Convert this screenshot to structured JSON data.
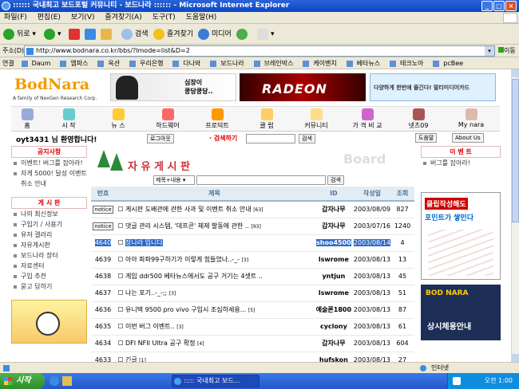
{
  "window": {
    "title": ":::::: 국내최고 보드포털 커뮤니티 - 보드나라 :::::: - Microsoft Internet Explorer"
  },
  "menu": [
    "파일(F)",
    "편집(E)",
    "보기(V)",
    "즐겨찾기(A)",
    "도구(T)",
    "도움말(H)"
  ],
  "toolbar": {
    "back": "뒤로",
    "search": "검색",
    "favorites": "즐겨찾기",
    "media": "미디어"
  },
  "address": {
    "label": "주소(D)",
    "url": "http://www.bodnara.co.kr/bbs/?lmode=list&D=2",
    "go": "이동"
  },
  "links": {
    "label": "연결",
    "items": [
      "Daum",
      "엠파스",
      "옥션",
      "우리은행",
      "다나와",
      "보드나라",
      "브레인박스",
      "케이벤치",
      "베타뉴스",
      "테크노아",
      "pcBee"
    ]
  },
  "site": {
    "logo": "BodNara",
    "logo_sub": "A family of NexGen Research Corp.",
    "banner1_text": "심장이\n쿵당쿵당..",
    "banner2_text": "RADEON",
    "banner3_text": "다양하게 한번에 즐긴다! 멀티미디어카드",
    "nav": [
      "홈",
      "시 작",
      "뉴 스",
      "하드웨어",
      "프로덕트",
      "클 럽",
      "커뮤니티",
      "가 격 비 교",
      "넷츠09",
      "My nara"
    ],
    "welcome": "oyt3431 님 환영합니다!",
    "logout": "로그아웃",
    "search_label": "· 검색하기",
    "search_btn": "검색",
    "help_btn": "도움말",
    "about_btn": "About Us"
  },
  "left": {
    "notice_head": "공지사항",
    "notices": [
      "이벤트! 버그를 잡아라!",
      "자게 5000! 달성 이벤트 취소 안내"
    ],
    "board_head": "게 시 판",
    "boards": [
      "나의 최신정보",
      "구입기 / 사용기",
      "유저 갤러리",
      "자유게시판",
      "보드나라 장터",
      "자료센터",
      "구입 추천",
      "묻고 답하기"
    ]
  },
  "board": {
    "title": "자 유 게 시 판",
    "watermark": "Board",
    "search_option": "제목+내용",
    "search_btn": "검색",
    "columns": [
      "번호",
      "제목",
      "ID",
      "작성일",
      "조회"
    ],
    "rows": [
      {
        "num": "notice",
        "subject": "게시판 도배관에 관한 사과 및 이벤트 취소 안내",
        "count": "[63]",
        "id": "갑자나무",
        "date": "2003/08/09",
        "hits": "827"
      },
      {
        "num": "notice",
        "subject": "댓글 관리 시스템, '데프콘' 체제 발동에 관한 ..",
        "count": "[93]",
        "id": "갑자나무",
        "date": "2003/07/16",
        "hits": "1240"
      },
      {
        "num": "4640",
        "subject": "장나라 입니다",
        "count": "",
        "id": "shoo4500",
        "date": "2003/08/14",
        "hits": "4"
      },
      {
        "num": "4639",
        "subject": "아아 파파99구하기가 이렇게 힘들었나..-_-",
        "count": "[3]",
        "id": "lswrome",
        "date": "2003/08/13",
        "hits": "13"
      },
      {
        "num": "4638",
        "subject": "게임 ddr500 베타뉴스에서도 공구 거기는 4셋트 ..",
        "count": "",
        "id": "yntjun",
        "date": "2003/08/13",
        "hits": "45"
      },
      {
        "num": "4637",
        "subject": "나는 포기..-_-;;",
        "count": "[3]",
        "id": "lswrome",
        "date": "2003/08/13",
        "hits": "51"
      },
      {
        "num": "4636",
        "subject": "유니텍 9500 pro vivo 구입시 조심하세용...",
        "count": "[5]",
        "id": "예술론1800",
        "date": "2003/08/13",
        "hits": "87"
      },
      {
        "num": "4635",
        "subject": "이번 버그 이벤트..",
        "count": "[3]",
        "id": "cyclony",
        "date": "2003/08/13",
        "hits": "61"
      },
      {
        "num": "4634",
        "subject": "DFI NFII Ultra 공구 확정",
        "count": "[4]",
        "id": "갑자나무",
        "date": "2003/08/13",
        "hits": "604"
      },
      {
        "num": "4633",
        "subject": "긴글",
        "count": "[1]",
        "id": "hufskon",
        "date": "2003/08/13",
        "hits": "27"
      }
    ]
  },
  "right": {
    "event_head": "이 벤 트",
    "events": [
      "버그를 잡아라!"
    ],
    "ad1_line1": "클립작성해도",
    "ad1_line2": "포인트가 쌓인다",
    "ad2_text": "BOD NARA",
    "ad2_sub": "상시체용안내"
  },
  "status": {
    "text": "인터넷"
  },
  "taskbar": {
    "start": "시작",
    "item": "::::: 국내최고 보드...",
    "clock": "오전 1:00"
  }
}
